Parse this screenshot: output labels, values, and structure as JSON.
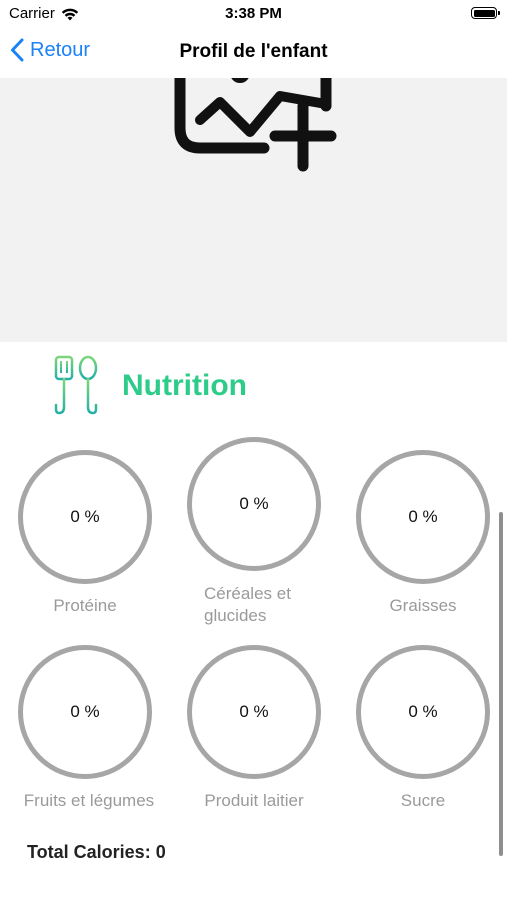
{
  "status_bar": {
    "carrier": "Carrier",
    "time": "3:38 PM",
    "wifi_icon": "wifi-icon",
    "battery_icon": "battery-icon"
  },
  "nav": {
    "back_label": "Retour",
    "title": "Profil de l'enfant"
  },
  "image_area": {
    "icon": "add-photo-icon",
    "background": "#f2f2f2"
  },
  "nutrition": {
    "title": "Nutrition",
    "icon": "utensils-icon",
    "accent_color": "#2ecc8a",
    "gauges": [
      {
        "label": "Protéine",
        "value": "0 %"
      },
      {
        "label": "Céréales et glucides",
        "value": "0 %"
      },
      {
        "label": "Graisses",
        "value": "0 %"
      },
      {
        "label": "Fruits et légumes",
        "value": "0 %"
      },
      {
        "label": "Produit laitier",
        "value": "0 %"
      },
      {
        "label": "Sucre",
        "value": "0 %"
      }
    ],
    "total_calories": "Total Calories: 0"
  },
  "colors": {
    "link": "#1a82f7",
    "ring": "#a6a6a6",
    "label": "#9a9a9a"
  }
}
